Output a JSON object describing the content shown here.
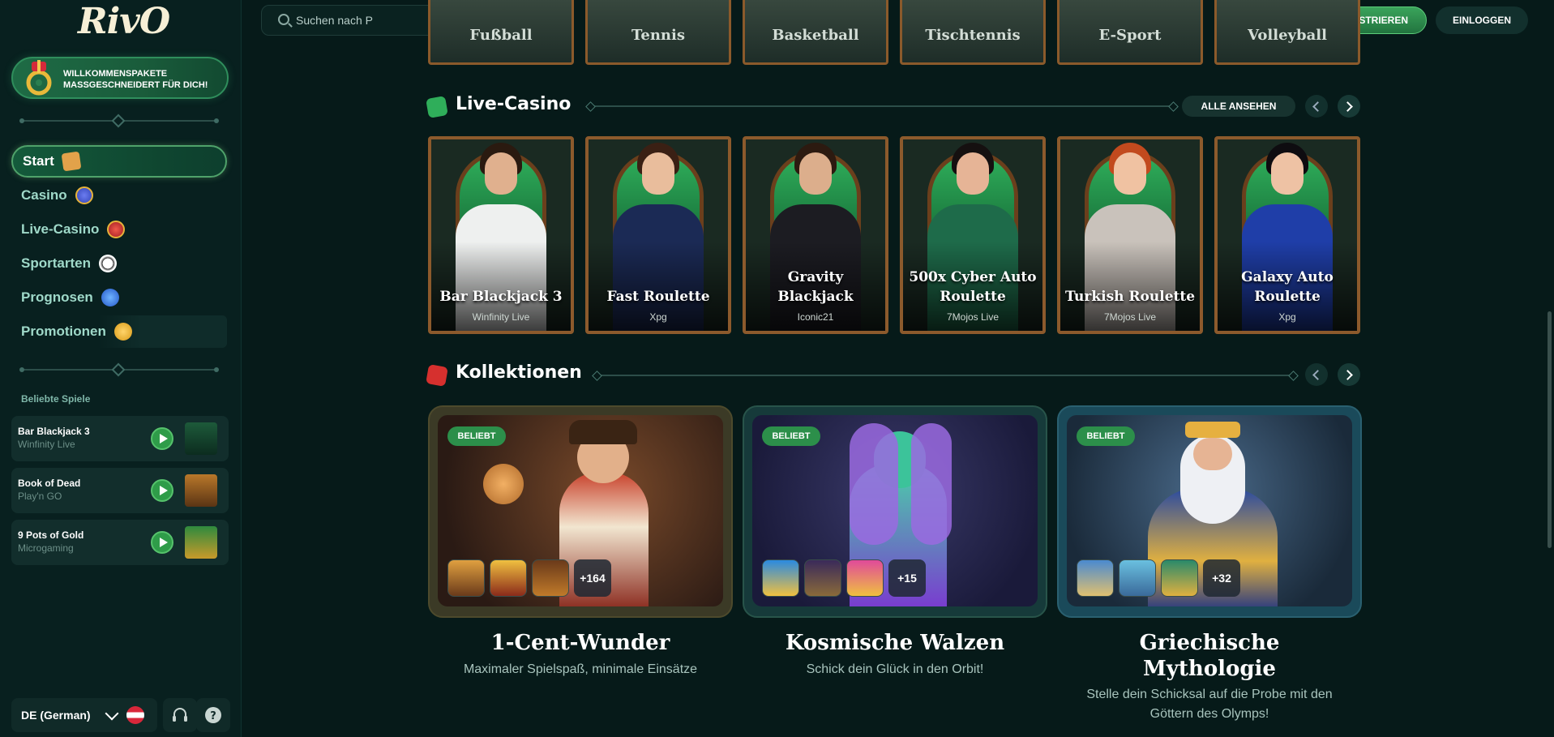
{
  "brand": {
    "logo": "RivO"
  },
  "sidebar": {
    "welcome": {
      "line1": "WILLKOMMENSPAKETE",
      "line2": "MASSGESCHNEIDERT FÜR DICH!"
    },
    "nav": [
      {
        "label": "Start",
        "icon": "ticket-icon"
      },
      {
        "label": "Casino",
        "icon": "gem-icon"
      },
      {
        "label": "Live-Casino",
        "icon": "ruby-icon"
      },
      {
        "label": "Sportarten",
        "icon": "soccer-ball-icon"
      },
      {
        "label": "Prognosen",
        "icon": "globe-icon"
      },
      {
        "label": "Promotionen",
        "icon": "gift-icon"
      }
    ],
    "favorites_label": "Beliebte Spiele",
    "favorites": [
      {
        "name": "Bar Blackjack 3",
        "provider": "Winfinity Live"
      },
      {
        "name": "Book of Dead",
        "provider": "Play'n GO"
      },
      {
        "name": "9 Pots of Gold",
        "provider": "Microgaming"
      }
    ],
    "language": "DE (German)"
  },
  "topbar": {
    "search_placeholder": "Suchen nach P",
    "register": "REGISTRIEREN",
    "login": "EINLOGGEN"
  },
  "sports": [
    "Fußball",
    "Tennis",
    "Basketball",
    "Tischtennis",
    "E-Sport",
    "Volleyball"
  ],
  "live_casino": {
    "title": "Live-Casino",
    "see_all": "ALLE ANSEHEN",
    "games": [
      {
        "name": "Bar Blackjack 3",
        "provider": "Winfinity Live"
      },
      {
        "name": "Fast Roulette",
        "provider": "Xpg"
      },
      {
        "name": "Gravity Blackjack",
        "provider": "Iconic21"
      },
      {
        "name": "500x Cyber Auto Roulette",
        "provider": "7Mojos Live"
      },
      {
        "name": "Turkish Roulette",
        "provider": "7Mojos Live"
      },
      {
        "name": "Galaxy Auto Roulette",
        "provider": "Xpg"
      }
    ]
  },
  "collections": {
    "title": "Kollektionen",
    "items": [
      {
        "badge": "BELIEBT",
        "more": "+164",
        "title": "1-Cent-Wunder",
        "subtitle": "Maximaler Spielspaß, minimale Einsätze"
      },
      {
        "badge": "BELIEBT",
        "more": "+15",
        "title": "Kosmische Walzen",
        "subtitle": "Schick dein Glück in den Orbit!"
      },
      {
        "badge": "BELIEBT",
        "more": "+32",
        "title": "Griechische Mythologie",
        "subtitle": "Stelle dein Schicksal auf die Probe mit den Göttern des Olymps!"
      }
    ]
  },
  "colors": {
    "accent": "#2f9c49",
    "background": "#061a19",
    "frame": "#8c5a2c"
  }
}
